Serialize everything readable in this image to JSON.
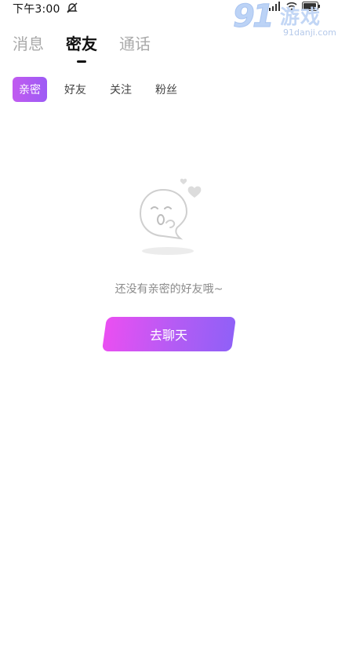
{
  "status_bar": {
    "time": "下午3:00",
    "mute_icon": "mute-bell-icon"
  },
  "watermark": {
    "logo_number": "91",
    "logo_text": "游戏",
    "url": "91danji.com"
  },
  "top_tabs": [
    {
      "label": "消息",
      "active": false
    },
    {
      "label": "密友",
      "active": true
    },
    {
      "label": "通话",
      "active": false
    }
  ],
  "sub_tabs": [
    {
      "label": "亲密",
      "active": true
    },
    {
      "label": "好友",
      "active": false
    },
    {
      "label": "关注",
      "active": false
    },
    {
      "label": "粉丝",
      "active": false
    }
  ],
  "empty_state": {
    "icon": "ghost-kiss-icon",
    "message": "还没有亲密的好友哦~",
    "button_label": "去聊天"
  },
  "colors": {
    "accent_start": "#ea4ff2",
    "accent_end": "#9060f7",
    "active_subtab": "#b45bf2"
  }
}
